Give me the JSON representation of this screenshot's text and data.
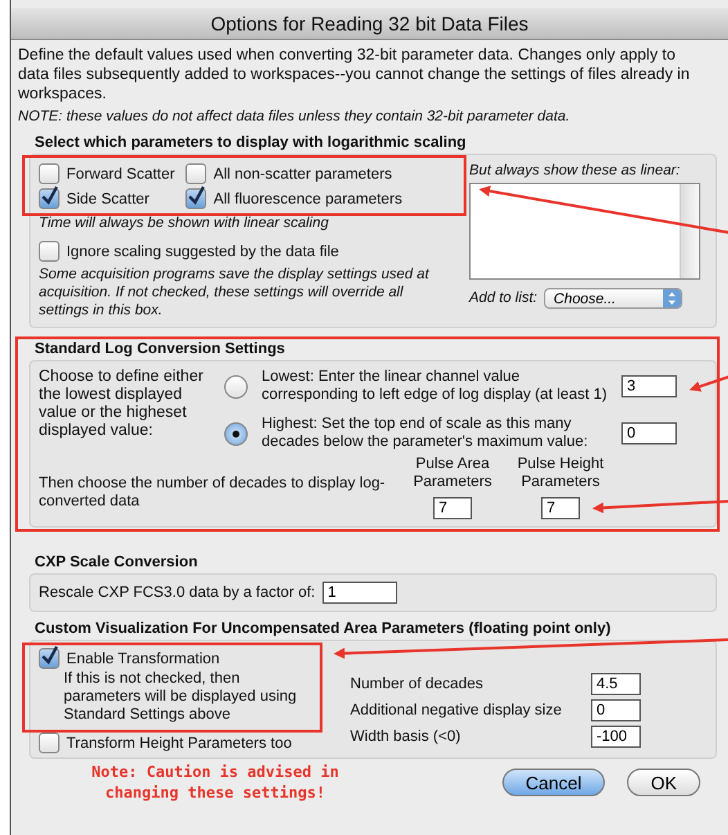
{
  "window": {
    "title": "Options for Reading 32 bit Data Files"
  },
  "intro": "Define the default values used when converting 32-bit parameter data.  Changes only apply to data files subsequently added to workspaces--you cannot change the settings of files already in workspaces.",
  "note": "NOTE:  these values do not affect data files unless they contain 32-bit parameter data.",
  "log_scaling": {
    "title": "Select which parameters to display with logarithmic scaling",
    "checkboxes": [
      {
        "label": "Forward Scatter",
        "checked": false
      },
      {
        "label": "All non-scatter parameters",
        "checked": false
      },
      {
        "label": "Side Scatter",
        "checked": true
      },
      {
        "label": "All fluorescence parameters",
        "checked": true
      }
    ],
    "time_note": "Time will always be shown with linear scaling",
    "ignore": {
      "label": "Ignore scaling suggested by the data file",
      "checked": false
    },
    "ignore_help": "Some acquisition programs save the display settings used at acquisition.  If not checked, these settings will override all settings in this box.",
    "linear_label": "But always show these as linear:",
    "add_label": "Add to list:",
    "add_select": "Choose..."
  },
  "log_conversion": {
    "title": "Standard Log Conversion Settings",
    "prompt": "Choose to define either the lowest displayed value or the higheset displayed value:",
    "options": [
      {
        "label": "Lowest: Enter the linear channel value corresponding to left edge of log display (at least 1)",
        "selected": false,
        "value": "3"
      },
      {
        "label": "Highest: Set the top end of scale as this many decades below the parameter's maximum value:",
        "selected": true,
        "value": "0"
      }
    ],
    "decades_prompt": "Then choose the number of decades to display log-converted data",
    "decades": [
      {
        "label": "Pulse Area Parameters",
        "value": "7"
      },
      {
        "label": "Pulse Height Parameters",
        "value": "7"
      }
    ]
  },
  "cxp": {
    "title": "CXP Scale Conversion",
    "label": "Rescale CXP FCS3.0 data by a factor of:",
    "value": "1"
  },
  "custom": {
    "title": "Custom Visualization For Uncompensated Area Parameters (floating point only)",
    "enable": {
      "label": "Enable Transformation",
      "checked": true
    },
    "enable_help": "If this is not checked, then parameters will be displayed using Standard Settings above",
    "height": {
      "label": "Transform Height Parameters too",
      "checked": false
    },
    "fields": [
      {
        "label": "Number of decades",
        "value": "4.5"
      },
      {
        "label": "Additional negative display size",
        "value": "0"
      },
      {
        "label": "Width basis (<0)",
        "value": "-100"
      }
    ]
  },
  "caution": "Note:   Caution is advised in changing these settings!",
  "buttons": [
    {
      "label": "Cancel",
      "default": true
    },
    {
      "label": "OK",
      "default": false
    }
  ]
}
